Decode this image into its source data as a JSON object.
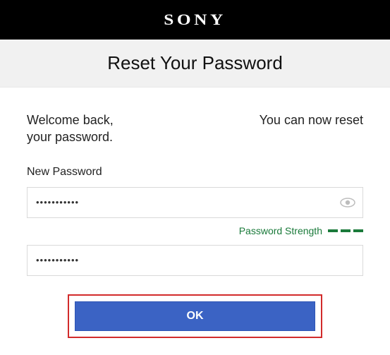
{
  "header": {
    "brand": "SONY"
  },
  "page": {
    "title": "Reset Your Password"
  },
  "welcome": {
    "left_line1": "Welcome back,",
    "left_line2": "your password.",
    "right": "You can now reset"
  },
  "form": {
    "new_password_label": "New Password",
    "new_password_value": "•••••••••••",
    "confirm_password_value": "•••••••••••",
    "strength_label": "Password Strength",
    "strength_bars": 3,
    "strength_color": "#1a7a3a",
    "ok_label": "OK"
  },
  "colors": {
    "highlight_border": "#d22b2b",
    "ok_button_bg": "#3b63c4"
  }
}
